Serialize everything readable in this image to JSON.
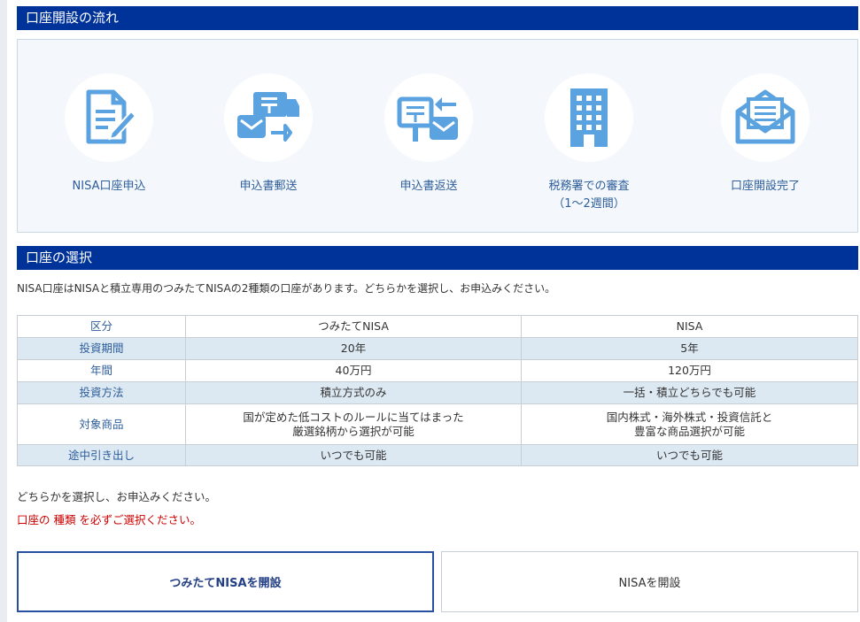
{
  "flow": {
    "title": "口座開設の流れ",
    "steps": [
      {
        "label": "NISA口座申込",
        "sublabel": "",
        "icon": "document-pen-icon"
      },
      {
        "label": "申込書郵送",
        "sublabel": "",
        "icon": "mail-truck-icon"
      },
      {
        "label": "申込書返送",
        "sublabel": "",
        "icon": "mailbox-return-icon"
      },
      {
        "label": "税務署での審査",
        "sublabel": "（1〜2週間）",
        "icon": "building-icon"
      },
      {
        "label": "口座開設完了",
        "sublabel": "",
        "icon": "open-envelope-icon"
      }
    ]
  },
  "selection": {
    "title": "口座の選択",
    "intro": "NISA口座はNISAと積立専用のつみたてNISAの2種類の口座があります。どちらかを選択し、お申込みください。",
    "table": {
      "headers": [
        "区分",
        "つみたてNISA",
        "NISA"
      ],
      "rows": [
        {
          "label": "投資期間",
          "tsumitate": "20年",
          "nisa": "5年"
        },
        {
          "label": "年間",
          "tsumitate": "40万円",
          "nisa": "120万円"
        },
        {
          "label": "投資方法",
          "tsumitate": "積立方式のみ",
          "nisa": "一括・積立どちらでも可能"
        },
        {
          "label": "対象商品",
          "tsumitate_1": "国が定めた低コストのルールに当てはまった",
          "tsumitate_2": "厳選銘柄から選択が可能",
          "nisa_1": "国内株式・海外株式・投資信託と",
          "nisa_2": "豊富な商品選択が可能"
        },
        {
          "label": "途中引き出し",
          "tsumitate": "いつでも可能",
          "nisa": "いつでも可能"
        }
      ]
    },
    "note": "どちらかを選択し、お申込みください。",
    "warning": "口座の 種類 を必ずご選択ください。",
    "buttons": {
      "tsumitate": "つみたてNISAを開設",
      "nisa": "NISAを開設"
    }
  },
  "colors": {
    "header_bg": "#003399",
    "icon_blue": "#5ba3e0",
    "table_shade": "#dde9f2",
    "warning": "#cc0000"
  }
}
